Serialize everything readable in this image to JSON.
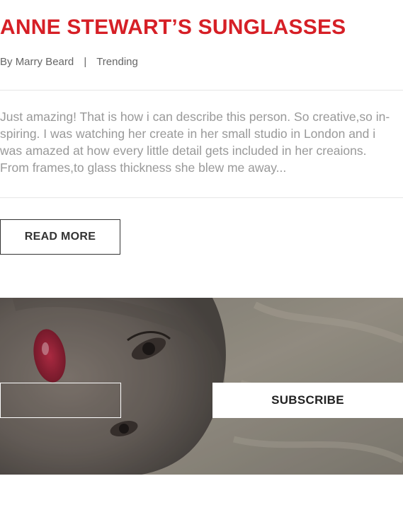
{
  "post": {
    "title": "ANNE STEWART’S SUNGLASSES",
    "by_label": "By",
    "author": "Marry Beard",
    "separator": "|",
    "category": "Trending",
    "excerpt": "Just amazing! That is how i can describe this person. So creative,so in-spiring. I was watching her create in her small studio in London and i was amazed at how every little detail gets included in her creaions. From frames,to glass thickness she blew me away...",
    "read_more_label": "READ MORE"
  },
  "newsletter": {
    "email_value": "",
    "email_placeholder": "",
    "subscribe_label": "SUBSCRIBE"
  },
  "colors": {
    "title_red": "#d61f26",
    "meta_gray": "#666666",
    "excerpt_gray": "#999999"
  }
}
